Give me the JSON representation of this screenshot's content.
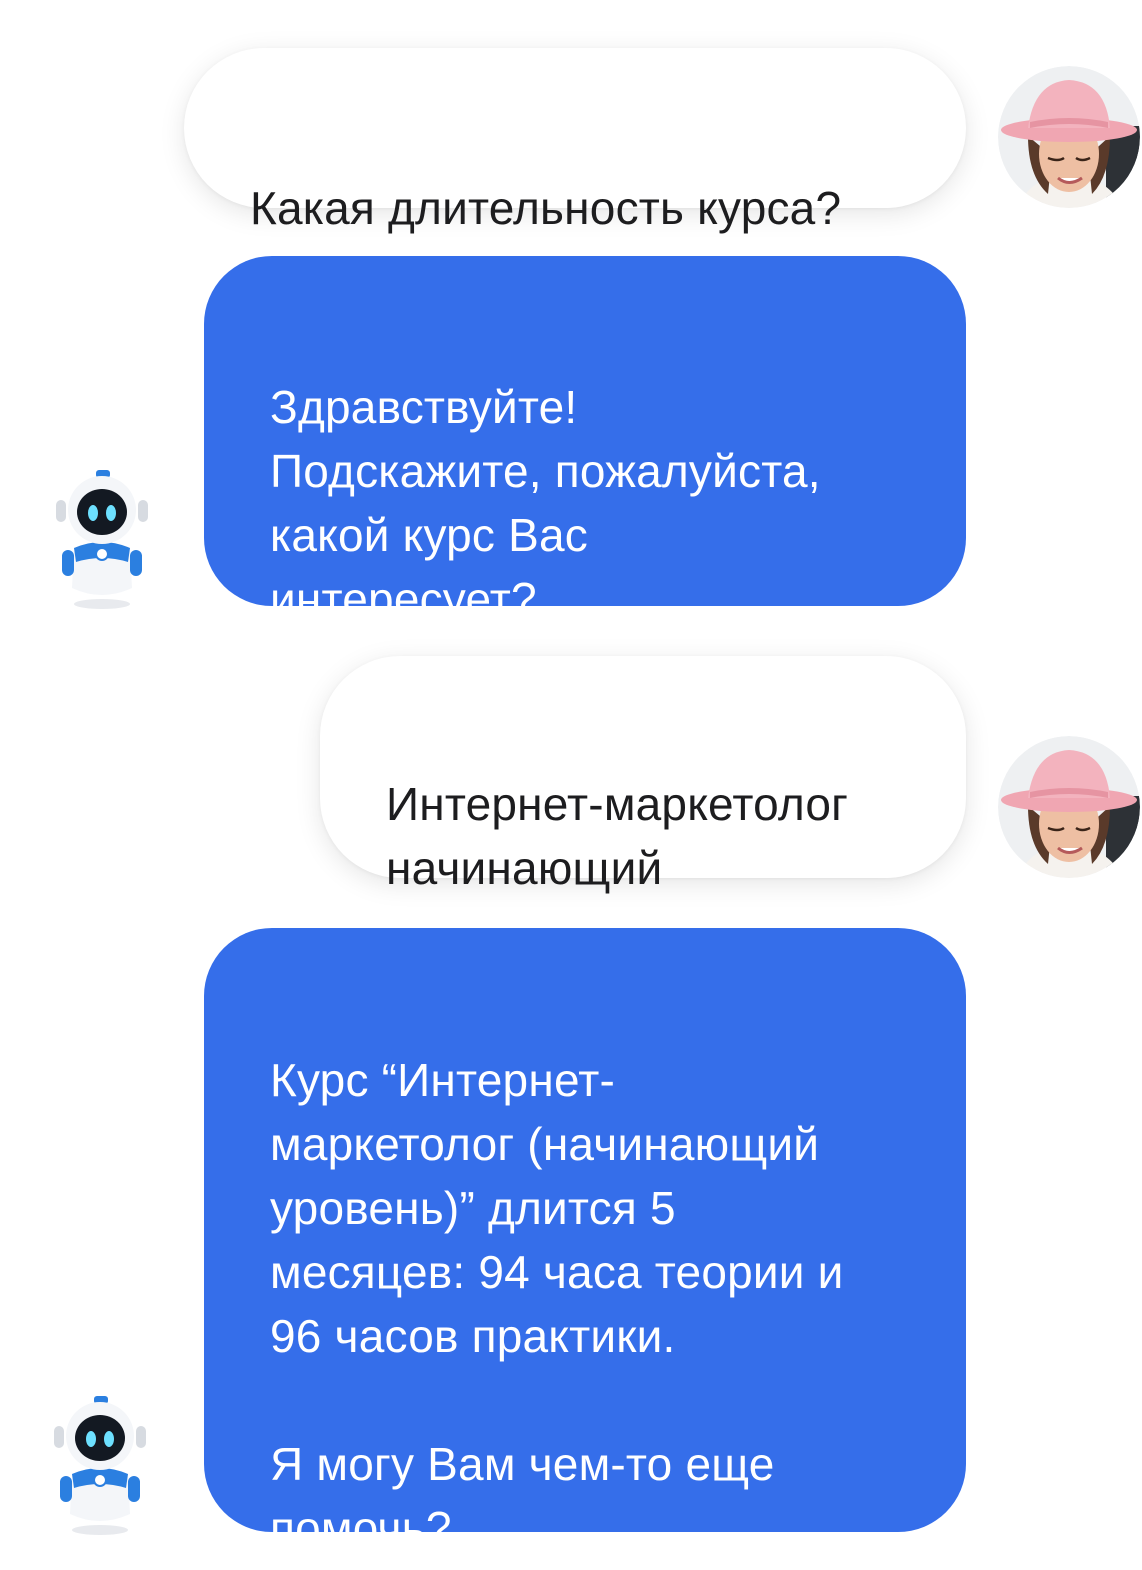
{
  "messages": [
    {
      "role": "user",
      "text": "Какая длительность курса?"
    },
    {
      "role": "bot",
      "text": "Здравствуйте!\nПодскажите, пожалуйста,\nкакой курс Вас\nинтересует?"
    },
    {
      "role": "user",
      "text": "Интернет-маркетолог\nначинающий"
    },
    {
      "role": "bot",
      "text": "Курс “Интернет-\nмаркетолог (начинающий\nуровень)” длится 5\nмесяцев: 94 часа теории и\n96 часов практики.\n\nЯ могу Вам чем-то еще\nпомочь?"
    }
  ],
  "avatars": {
    "user": "woman-pink-hat-avatar",
    "bot": "robot-assistant-avatar"
  },
  "colors": {
    "bot_bubble": "#356eea",
    "user_bubble": "#ffffff",
    "user_text": "#1d1d1f",
    "bot_text": "#ffffff"
  }
}
